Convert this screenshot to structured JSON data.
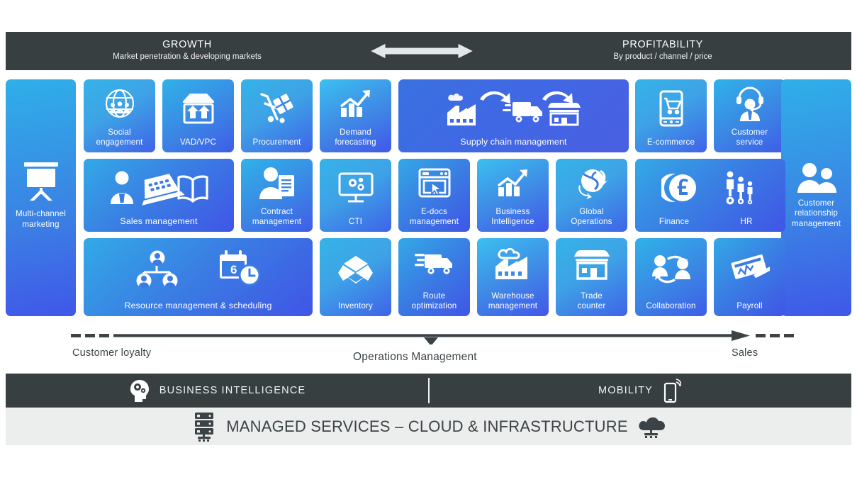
{
  "header": {
    "growth": {
      "title": "GROWTH",
      "subtitle": "Market penetration & developing markets"
    },
    "profitability": {
      "title": "PROFITABILITY",
      "subtitle": "By product / channel / price"
    },
    "arrow_icon": "double-headed-horizontal-arrow-icon"
  },
  "tiles": {
    "multi_channel_marketing": {
      "label": "Multi-channel\nmarketing",
      "icon": "presentation-board-icon"
    },
    "social_engagement": {
      "label": "Social\nengagement",
      "icon": "globe-people-icon"
    },
    "vad_vpc": {
      "label": "VAD/VPC",
      "icon": "open-box-arrows-up-icon"
    },
    "procurement": {
      "label": "Procurement",
      "icon": "hand-truck-parcel-icon"
    },
    "demand_forecasting": {
      "label": "Demand\nforecasting",
      "icon": "bar-chart-trend-up-icon"
    },
    "supply_chain_management": {
      "label": "Supply chain management",
      "icon": "factory-truck-store-flow-icon"
    },
    "e_commerce": {
      "label": "E-commerce",
      "icon": "smartphone-shopping-cart-icon"
    },
    "customer_service": {
      "label": "Customer\nservice",
      "icon": "headset-agent-icon"
    },
    "sales_management": {
      "label": "Sales management",
      "icon": "salesperson-laptop-book-icon"
    },
    "contract_management": {
      "label": "Contract\nmanagement",
      "icon": "person-document-icon"
    },
    "cti": {
      "label": "CTI",
      "icon": "monitor-gears-icon"
    },
    "edocs_management": {
      "label": "E-docs\nmanagement",
      "icon": "browser-window-cursor-icon"
    },
    "business_intelligence": {
      "label": "Business\nIntelligence",
      "icon": "bar-chart-trend-up-icon"
    },
    "global_operations": {
      "label": "Global\nOperations",
      "icon": "globe-arrows-icon"
    },
    "finance": {
      "label": "Finance",
      "icon": "pound-coins-icon"
    },
    "hr": {
      "label": "HR",
      "icon": "people-gears-icon"
    },
    "resource_scheduling": {
      "label": "Resource management & scheduling",
      "icon": "org-chart-calendar-clock-icon"
    },
    "inventory": {
      "label": "Inventory",
      "icon": "open-carton-icon"
    },
    "route_optimization": {
      "label": "Route\noptimization",
      "icon": "fast-delivery-truck-icon"
    },
    "warehouse_management": {
      "label": "Warehouse\nmanagement",
      "icon": "factory-cloud-icon"
    },
    "trade_counter": {
      "label": "Trade\ncounter",
      "icon": "shop-awning-icon"
    },
    "collaboration": {
      "label": "Collaboration",
      "icon": "two-people-cycle-arrows-icon"
    },
    "payroll": {
      "label": "Payroll",
      "icon": "cheque-pen-icon"
    },
    "customer_relationship_management": {
      "label": "Customer\nrelationship\nmanagement",
      "icon": "two-people-icon"
    }
  },
  "flow": {
    "left_label": "Customer loyalty",
    "middle_label": "Operations Management",
    "right_label": "Sales",
    "arrow_icon": "long-right-arrow-icon",
    "pointer_icon": "down-triangle-pointer-icon",
    "dash_icon": "dashed-line-icon"
  },
  "footer": {
    "business_intelligence": {
      "label": "BUSINESS INTELLIGENCE",
      "icon": "head-gears-icon"
    },
    "mobility": {
      "label": "MOBILITY",
      "icon": "smartphone-signal-icon"
    },
    "managed_services": {
      "label": "MANAGED SERVICES – CLOUD & INFRASTRUCTURE",
      "left_icon": "server-rack-network-icon",
      "right_icon": "cloud-network-icon"
    }
  },
  "colors": {
    "dark_bar": "#373f41",
    "light_bar": "#eceded",
    "tile_cyan": "#35b3e8",
    "tile_indigo": "#4057e8",
    "text_dark": "#3c4346",
    "white": "#ffffff"
  }
}
